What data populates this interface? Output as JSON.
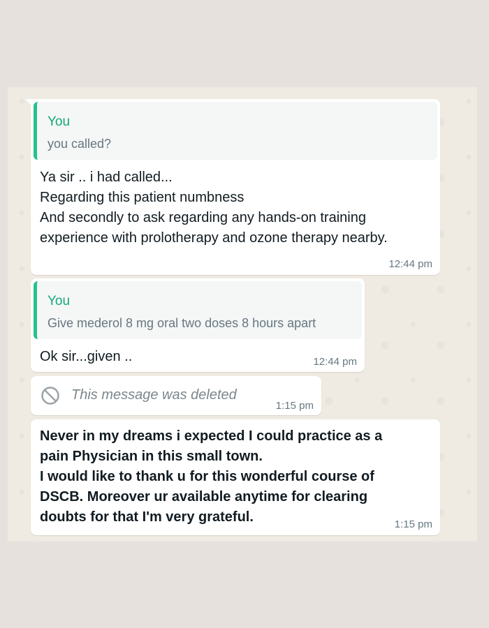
{
  "messages": [
    {
      "quote_author": "You",
      "quote_text": "you called?",
      "lines": [
        "Ya sir .. i had called...",
        "Regarding this patient numbness",
        "And secondly to ask regarding any hands-on training",
        "experience with prolotherapy and ozone therapy nearby."
      ],
      "time": "12:44 pm"
    },
    {
      "quote_author": "You",
      "quote_text": "Give mederol 8 mg oral two doses 8 hours apart",
      "lines": [
        "Ok sir...given .."
      ],
      "time": "12:44 pm"
    },
    {
      "deleted_text": "This message was deleted",
      "time": "1:15 pm"
    },
    {
      "lines": [
        "Never in my dreams i expected I could practice as a",
        "pain Physician in this small town.",
        "I would like to thank u for this wonderful course of",
        "DSCB. Moreover ur available anytime for clearing",
        "doubts for that I'm very grateful."
      ],
      "time": "1:15 pm"
    }
  ],
  "colors": {
    "quote_bar": "#25c08f",
    "quote_author": "#18a77a",
    "bubble": "#ffffff",
    "chat_bg": "#efeae2"
  },
  "icons": {
    "deleted": "blocked-circle-icon"
  }
}
